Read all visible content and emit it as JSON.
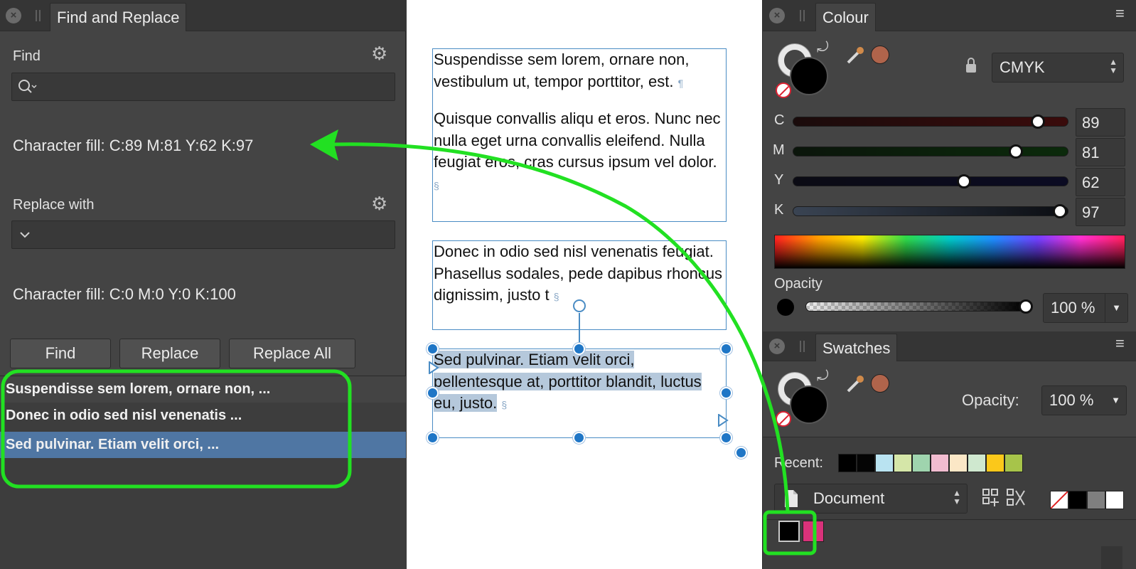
{
  "find_replace": {
    "tab_title": "Find and Replace",
    "find_label": "Find",
    "find_value": "",
    "find_criteria": "Character fill: C:89 M:81 Y:62 K:97",
    "replace_label": "Replace with",
    "replace_value": "",
    "replace_criteria": "Character fill: C:0 M:0 Y:0 K:100",
    "buttons": {
      "find": "Find",
      "replace": "Replace",
      "replace_all": "Replace All"
    },
    "results": [
      "Suspendisse sem lorem, ornare non, ...",
      "Donec in odio sed nisl venenatis ...",
      "Sed pulvinar. Etiam velit orci, ..."
    ]
  },
  "document": {
    "frame1": {
      "p1": "Suspendisse sem lorem, ornare non, vestibulum ut, tempor porttitor, est.",
      "p2": "Quisque convallis aliqu et eros. Nunc nec nulla eget urna convallis eleifend. Nulla feugiat eros, cras cursus ipsum vel dolor."
    },
    "frame2": {
      "p1": "Donec in odio sed nisl venenatis feugiat. Phasellus sodales, pede dapibus rhoncus dignissim, justo t"
    },
    "frame3": {
      "p1": "Sed pulvinar. Etiam velit orci, pellentesque at, porttitor blandit, luctus eu, justo."
    },
    "pilcrow": "¶",
    "section_mark": "§"
  },
  "colour": {
    "tab_title": "Colour",
    "model": "CMYK",
    "sliders": [
      {
        "label": "C",
        "value": "89",
        "fraction": 0.89
      },
      {
        "label": "M",
        "value": "81",
        "fraction": 0.81
      },
      {
        "label": "Y",
        "value": "62",
        "fraction": 0.62
      },
      {
        "label": "K",
        "value": "97",
        "fraction": 0.97
      }
    ],
    "opacity_label": "Opacity",
    "opacity_value": "100 %",
    "opacity_fraction": 1.0
  },
  "swatches": {
    "tab_title": "Swatches",
    "opacity_label": "Opacity:",
    "opacity_value": "100 %",
    "recent_label": "Recent:",
    "recent_colors": [
      "#000000",
      "#050505",
      "#b9e3f1",
      "#d5e6a8",
      "#9fd4ae",
      "#f2bcd0",
      "#fbe7c6",
      "#cfe8cf",
      "#fbc81a",
      "#a7c44a"
    ],
    "palette": "Document",
    "quick_colors": [
      "#000000",
      "#7f7f7f",
      "#ffffff"
    ],
    "document_swatches": [
      "#000000",
      "#d9327a"
    ]
  },
  "colors": {
    "accent": "#1f76c6",
    "selection": "#4f76a3",
    "annotation": "#22e022"
  }
}
